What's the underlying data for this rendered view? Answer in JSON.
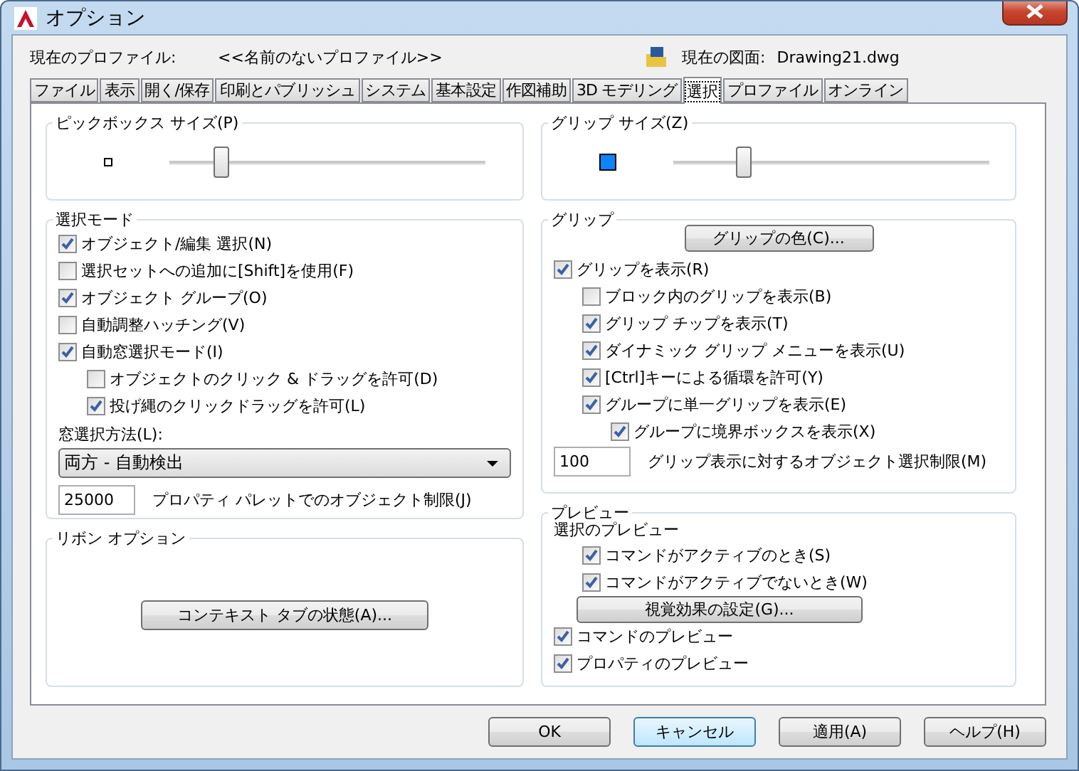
{
  "window": {
    "title": "オプション"
  },
  "profile": {
    "label": "現在のプロファイル:",
    "value": "<<名前のないプロファイル>>"
  },
  "drawing": {
    "label": "現在の図面:",
    "value": "Drawing21.dwg"
  },
  "tabs": [
    {
      "label": "ファイル",
      "selected": false
    },
    {
      "label": "表示",
      "selected": false
    },
    {
      "label": "開く/保存",
      "selected": false
    },
    {
      "label": "印刷とパブリッシュ",
      "selected": false
    },
    {
      "label": "システム",
      "selected": false
    },
    {
      "label": "基本設定",
      "selected": false
    },
    {
      "label": "作図補助",
      "selected": false
    },
    {
      "label": "3D モデリング",
      "selected": false
    },
    {
      "label": "選択",
      "selected": true
    },
    {
      "label": "プロファイル",
      "selected": false
    },
    {
      "label": "オンライン",
      "selected": false
    }
  ],
  "pickbox_size": {
    "title": "ピックボックス サイズ(P)",
    "level": 0.16
  },
  "selection_modes": {
    "title": "選択モード",
    "options": [
      {
        "label": "オブジェクト/編集 選択(N)",
        "checked": true
      },
      {
        "label": "選択セットへの追加に[Shift]を使用(F)",
        "checked": false
      },
      {
        "label": "オブジェクト グループ(O)",
        "checked": true
      },
      {
        "label": "自動調整ハッチング(V)",
        "checked": false
      },
      {
        "label": "自動窓選択モード(I)",
        "checked": true,
        "children": [
          {
            "label": "オブジェクトのクリック & ドラッグを許可(D)",
            "checked": false
          },
          {
            "label": "投げ縄のクリックドラッグを許可(L)",
            "checked": true
          }
        ]
      }
    ],
    "window_method": {
      "label": "窓選択方法(L):",
      "value": "両方 - 自動検出"
    },
    "object_limit": {
      "value": "25000",
      "label": "プロパティ パレットでのオブジェクト制限(J)"
    }
  },
  "ribbon_options": {
    "title": "リボン オプション",
    "button": "コンテキスト タブの状態(A)..."
  },
  "grip_size": {
    "title": "グリップ サイズ(Z)",
    "level": 0.22
  },
  "grips": {
    "title": "グリップ",
    "color_button": "グリップの色(C)...",
    "options": [
      {
        "label": "グリップを表示(R)",
        "checked": true,
        "children": [
          {
            "label": "ブロック内のグリップを表示(B)",
            "checked": false
          },
          {
            "label": "グリップ チップを表示(T)",
            "checked": true
          },
          {
            "label": "ダイナミック グリップ メニューを表示(U)",
            "checked": true
          },
          {
            "label": "[Ctrl]キーによる循環を許可(Y)",
            "checked": true
          },
          {
            "label": "グループに単一グリップを表示(E)",
            "checked": true,
            "children": [
              {
                "label": "グループに境界ボックスを表示(X)",
                "checked": true
              }
            ]
          }
        ]
      }
    ],
    "limit": {
      "value": "100",
      "label": "グリップ表示に対するオブジェクト選択制限(M)"
    }
  },
  "preview": {
    "title": "プレビュー",
    "selection": {
      "label": "選択のプレビュー",
      "options": [
        {
          "label": "コマンドがアクティブのとき(S)",
          "checked": true
        },
        {
          "label": "コマンドがアクティブでないとき(W)",
          "checked": true
        }
      ],
      "button": "視覚効果の設定(G)..."
    },
    "options": [
      {
        "label": "コマンドのプレビュー",
        "checked": true
      },
      {
        "label": "プロパティのプレビュー",
        "checked": true
      }
    ]
  },
  "buttons": [
    {
      "label": "OK",
      "default": false
    },
    {
      "label": "キャンセル",
      "default": true
    },
    {
      "label": "適用(A)",
      "default": false
    },
    {
      "label": "ヘルプ(H)",
      "default": false
    }
  ]
}
